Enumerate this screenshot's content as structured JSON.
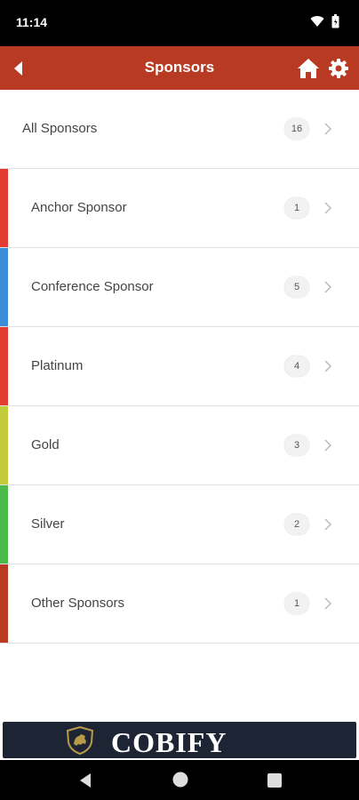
{
  "status": {
    "time": "11:14"
  },
  "app_bar": {
    "title": "Sponsors",
    "icons": [
      "back-arrow-icon",
      "home-icon",
      "gear-icon"
    ]
  },
  "sponsors": {
    "all": {
      "label": "All Sponsors",
      "count": "16"
    },
    "categories": [
      {
        "label": "Anchor Sponsor",
        "count": "1",
        "color": "#e23c32"
      },
      {
        "label": "Conference Sponsor",
        "count": "5",
        "color": "#3a8ed8"
      },
      {
        "label": "Platinum",
        "count": "4",
        "color": "#e23c32"
      },
      {
        "label": "Gold",
        "count": "3",
        "color": "#c2cc3a"
      },
      {
        "label": "Silver",
        "count": "2",
        "color": "#4cba4a"
      },
      {
        "label": "Other Sponsors",
        "count": "1",
        "color": "#b83a22"
      }
    ]
  },
  "banner": {
    "text": "COBIFY",
    "background": "#1d2535",
    "logo_color": "#b89a48"
  },
  "colors": {
    "app_bar": "#b83a22",
    "status_bar": "#000000"
  }
}
